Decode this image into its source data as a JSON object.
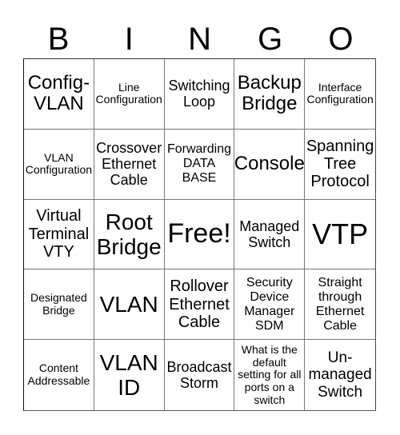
{
  "header": {
    "letters": [
      "B",
      "I",
      "N",
      "G",
      "O"
    ]
  },
  "cells": [
    [
      "Config-VLAN",
      "Line Configuration",
      "Switching Loop",
      "Backup Bridge",
      "Interface Configuration"
    ],
    [
      "VLAN Configuration",
      "Crossover Ethernet Cable",
      "Forwarding DATA BASE",
      "Console",
      "Spanning Tree Protocol"
    ],
    [
      "Virtual Terminal VTY",
      "Root Bridge",
      "Free!",
      "Managed Switch",
      "VTP"
    ],
    [
      "Designated Bridge",
      "VLAN",
      "Rollover Ethernet Cable",
      "Security Device Manager SDM",
      "Straight through Ethernet Cable"
    ],
    [
      "Content Addressable",
      "VLAN ID",
      "Broadcast Storm",
      "What is the default setting for all ports on a switch",
      "Un-managed Switch"
    ]
  ]
}
